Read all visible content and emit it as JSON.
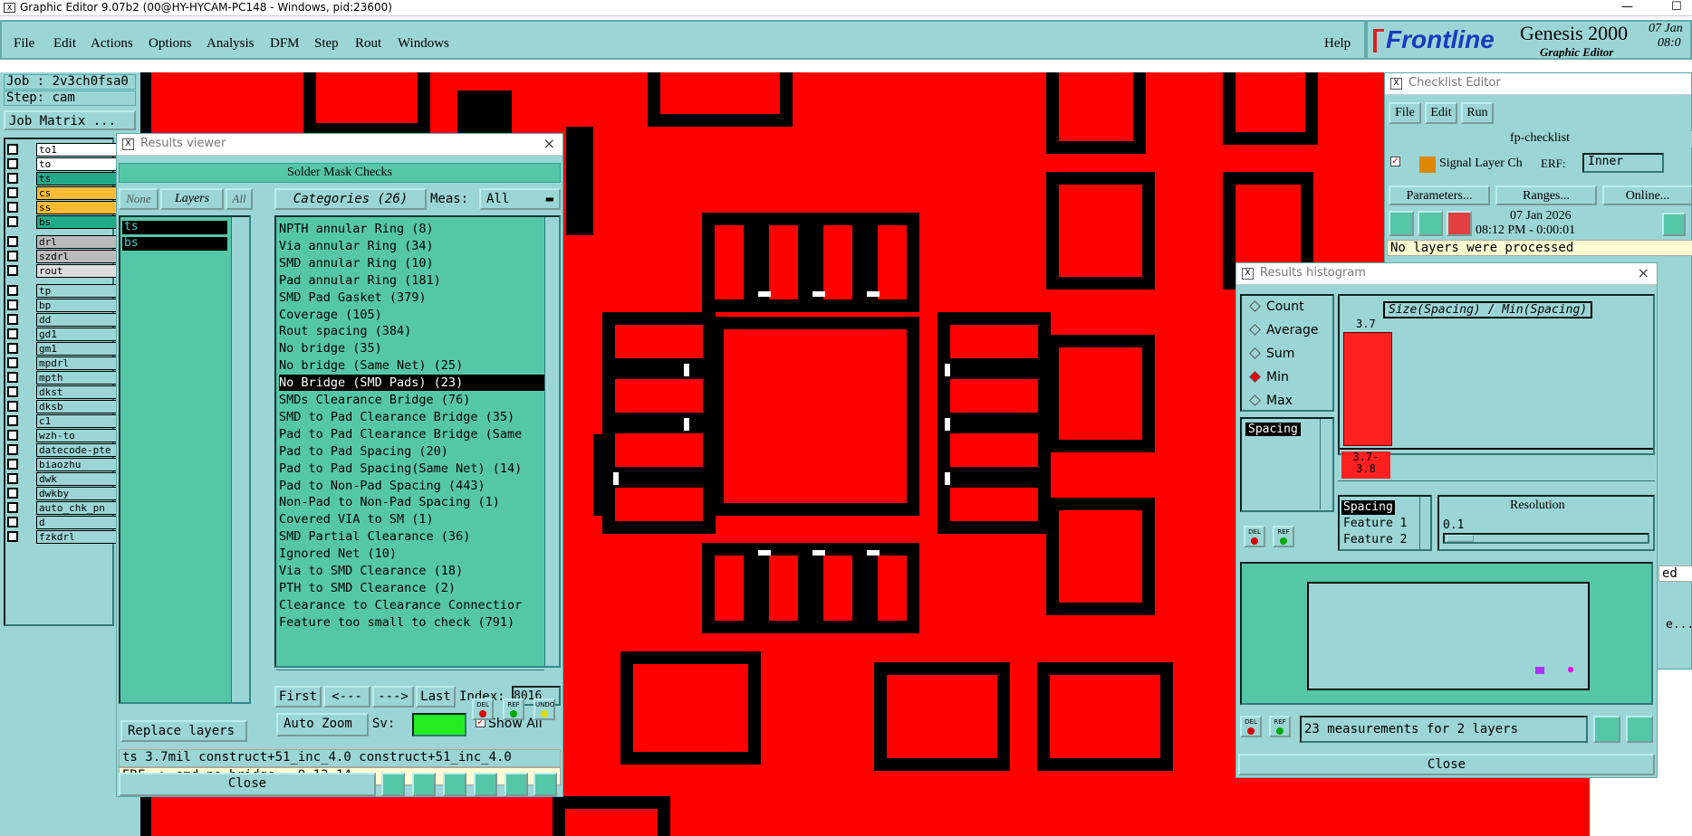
{
  "title": "Graphic Editor 9.07b2 (00@HY-HYCAM-PC148 - Windows, pid:23600)",
  "menu": {
    "file": "File",
    "edit": "Edit",
    "actions": "Actions",
    "options": "Options",
    "analysis": "Analysis",
    "dfm": "DFM",
    "step": "Step",
    "rout": "Rout",
    "windows": "Windows",
    "help": "Help"
  },
  "logo": {
    "brand": "Frontline",
    "product": "Genesis 2000",
    "subtitle": "Graphic Editor",
    "date": "07 Jan",
    "time": "08:0"
  },
  "job": {
    "job": "Job : 2v3ch0fsa0",
    "step": "Step: cam",
    "matrix": "Job Matrix ..."
  },
  "layers": [
    {
      "name": "to1",
      "bg": "#ffffff"
    },
    {
      "name": "to",
      "bg": "#ffffff"
    },
    {
      "name": "ts",
      "bg": "#22aa88"
    },
    {
      "name": "cs",
      "bg": "#ffbb33"
    },
    {
      "name": "ss",
      "bg": "#ffbb33"
    },
    {
      "name": "bs",
      "bg": "#22aa88"
    },
    {
      "name": "drl",
      "bg": "#bbbbbb"
    },
    {
      "name": "szdrl",
      "bg": "#bbbbbb"
    },
    {
      "name": "rout",
      "bg": "#dddddd"
    },
    {
      "name": "tp",
      "bg": "#9cd5d5"
    },
    {
      "name": "bp",
      "bg": "#9cd5d5"
    },
    {
      "name": "dd",
      "bg": "#9cd5d5"
    },
    {
      "name": "gd1",
      "bg": "#9cd5d5"
    },
    {
      "name": "gm1",
      "bg": "#9cd5d5"
    },
    {
      "name": "mpdrl",
      "bg": "#9cd5d5"
    },
    {
      "name": "mpth",
      "bg": "#9cd5d5"
    },
    {
      "name": "dkst",
      "bg": "#9cd5d5"
    },
    {
      "name": "dksb",
      "bg": "#9cd5d5"
    },
    {
      "name": "c1",
      "bg": "#9cd5d5"
    },
    {
      "name": "wzh-to",
      "bg": "#9cd5d5"
    },
    {
      "name": "datecode-pte",
      "bg": "#9cd5d5"
    },
    {
      "name": "biaozhu",
      "bg": "#9cd5d5"
    },
    {
      "name": "dwk",
      "bg": "#9cd5d5"
    },
    {
      "name": "dwkby",
      "bg": "#9cd5d5"
    },
    {
      "name": "auto_chk_pn",
      "bg": "#9cd5d5"
    },
    {
      "name": "d",
      "bg": "#9cd5d5"
    },
    {
      "name": "fzkdrl",
      "bg": "#9cd5d5"
    }
  ],
  "results": {
    "title": "Results viewer",
    "header": "Solder Mask Checks",
    "none": "None",
    "layers_btn": "Layers",
    "all": "All",
    "categories_btn": "Categories (26)",
    "meas_label": "Meas:",
    "meas_value": "All",
    "layer_items": [
      "ts",
      "bs"
    ],
    "categories": [
      "NPTH annular Ring (8)",
      "Via annular Ring (34)",
      "SMD annular Ring (10)",
      "Pad annular Ring (181)",
      "SMD Pad Gasket (379)",
      "Coverage (105)",
      "Rout spacing (384)",
      "No bridge (35)",
      "No bridge (Same Net) (25)",
      "No Bridge (SMD Pads) (23)",
      "SMDs Clearance Bridge (76)",
      "SMD to Pad Clearance Bridge (35)",
      "Pad to Pad Clearance Bridge (Same",
      "Pad to Pad Spacing (20)",
      "Pad to Pad Spacing(Same Net) (14)",
      "Pad to Non-Pad Spacing (443)",
      "Non-Pad to Non-Pad Spacing (1)",
      "Covered VIA to SM (1)",
      "SMD Partial Clearance (36)",
      "Ignored Net (10)",
      "Via to SMD Clearance (18)",
      "PTH to SMD Clearance (2)",
      "Clearance to Clearance Connectior",
      "Feature too small to check (791)"
    ],
    "first": "First",
    "prev": "<---",
    "next": "--->",
    "last": "Last",
    "index_label": "Index:",
    "index_value": "8016",
    "autozoom": "Auto Zoom",
    "sv": "Sv:",
    "showall": "Show All",
    "replace": "Replace layers",
    "del": "DEL",
    "ref": "REF",
    "undo": "UNDO",
    "status1": "ts 3.7mil  construct+51_inc_4.0  construct+51_inc_4.0",
    "status2": "ERF--> smd_no_bridge = 9 12 14",
    "close": "Close"
  },
  "checklist": {
    "title": "Checklist Editor",
    "file": "File",
    "edit": "Edit",
    "run": "Run",
    "name": "fp-checklist",
    "action": "Signal Layer Ch",
    "erf": "ERF:",
    "erf_value": "Inner",
    "params": "Parameters...",
    "ranges": "Ranges...",
    "online": "Online...",
    "date": "07 Jan 2026",
    "time": "08:12 PM - 0:00:01",
    "status": "No layers were processed",
    "side": "ed",
    "side2": "e..."
  },
  "histogram": {
    "title": "Results histogram",
    "count": "Count",
    "average": "Average",
    "sum": "Sum",
    "min": "Min",
    "max": "Max",
    "list_item": "Spacing",
    "chart_title": "Size(Spacing) / Min(Spacing)",
    "bar_value": "3.7",
    "bin_label_1": "3.7-",
    "bin_label_2": "3.8",
    "attrs": [
      "Spacing",
      "Feature 1",
      "Feature 2"
    ],
    "resolution_label": "Resolution",
    "resolution_value": "0.1",
    "footer": "23 measurements for 2 layers",
    "close": "Close",
    "del": "DEL",
    "ref": "REF"
  }
}
